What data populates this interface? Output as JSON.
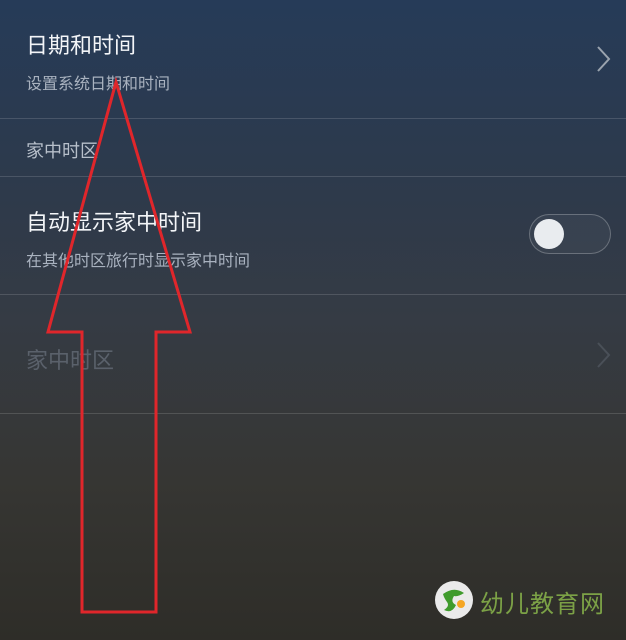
{
  "settings": {
    "date_time": {
      "title": "日期和时间",
      "subtitle": "设置系统日期和时间"
    },
    "home_timezone_section": "家中时区",
    "auto_home_time": {
      "title": "自动显示家中时间",
      "subtitle": "在其他时区旅行时显示家中时间",
      "toggle_on": false
    },
    "home_timezone_item": {
      "title": "家中时区",
      "enabled": false
    }
  },
  "annotation": {
    "type": "arrow",
    "direction": "up",
    "color": "#e0262b"
  },
  "watermark": {
    "text": "幼儿教育网",
    "logo": "jyi35-logo-icon",
    "color": "#9cc84a"
  },
  "icons": {
    "chevron": "chevron-right-icon"
  }
}
